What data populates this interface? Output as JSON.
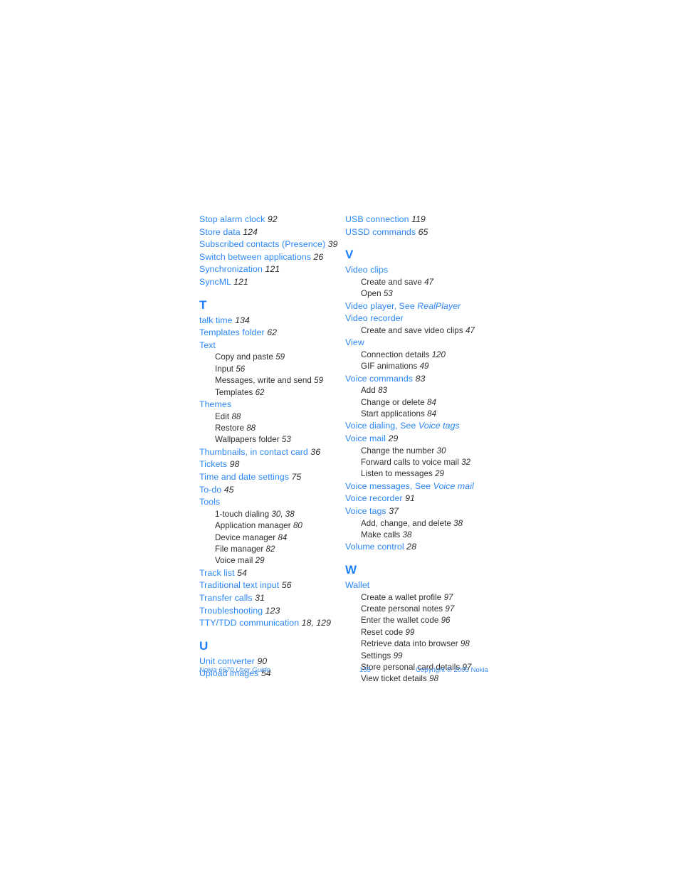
{
  "document": {
    "type": "index-page",
    "accent_color": "#2b87f4",
    "heading_color": "#1e7ffa",
    "body_color": "#2c2c2c",
    "background_color": "#ffffff"
  },
  "columns": [
    {
      "name": "left-column",
      "sections": [
        {
          "letter": "",
          "entries": [
            {
              "label": "Stop alarm clock",
              "page": "92",
              "subentries": []
            },
            {
              "label": "Store data",
              "page": "124",
              "subentries": []
            },
            {
              "label": "Subscribed contacts (Presence)",
              "page": "39",
              "subentries": []
            },
            {
              "label": "Switch between applications",
              "page": "26",
              "subentries": []
            },
            {
              "label": "Synchronization",
              "page": "121",
              "subentries": []
            },
            {
              "label": "SyncML",
              "page": "121",
              "subentries": []
            }
          ]
        },
        {
          "letter": "T",
          "entries": [
            {
              "label": "talk time",
              "page": "134",
              "subentries": []
            },
            {
              "label": "Templates folder",
              "page": "62",
              "subentries": []
            },
            {
              "label": "Text",
              "page": "",
              "subentries": [
                {
                  "label": "Copy and paste",
                  "page": "59"
                },
                {
                  "label": "Input",
                  "page": "56"
                },
                {
                  "label": "Messages, write and send",
                  "page": "59"
                },
                {
                  "label": "Templates",
                  "page": "62"
                }
              ]
            },
            {
              "label": "Themes",
              "page": "",
              "subentries": [
                {
                  "label": "Edit",
                  "page": "88"
                },
                {
                  "label": "Restore",
                  "page": "88"
                },
                {
                  "label": "Wallpapers folder",
                  "page": "53"
                }
              ]
            },
            {
              "label": "Thumbnails, in contact card",
              "page": "36",
              "subentries": []
            },
            {
              "label": "Tickets",
              "page": "98",
              "subentries": []
            },
            {
              "label": "Time and date settings",
              "page": "75",
              "subentries": []
            },
            {
              "label": "To-do",
              "page": "45",
              "subentries": []
            },
            {
              "label": "Tools",
              "page": "",
              "subentries": [
                {
                  "label": "1-touch dialing",
                  "page": "30, 38"
                },
                {
                  "label": "Application manager",
                  "page": "80"
                },
                {
                  "label": "Device manager",
                  "page": "84"
                },
                {
                  "label": "File manager",
                  "page": "82"
                },
                {
                  "label": "Voice mail",
                  "page": "29"
                }
              ]
            },
            {
              "label": "Track list",
              "page": "54",
              "subentries": []
            },
            {
              "label": "Traditional text input",
              "page": "56",
              "subentries": []
            },
            {
              "label": "Transfer calls",
              "page": "31",
              "subentries": []
            },
            {
              "label": "Troubleshooting",
              "page": "123",
              "subentries": []
            },
            {
              "label": "TTY/TDD communication",
              "page": "18, 129",
              "subentries": []
            }
          ]
        },
        {
          "letter": "U",
          "entries": [
            {
              "label": "Unit converter",
              "page": "90",
              "subentries": []
            },
            {
              "label": "Upload images",
              "page": "54",
              "subentries": []
            }
          ]
        }
      ]
    },
    {
      "name": "right-column",
      "sections": [
        {
          "letter": "",
          "entries": [
            {
              "label": "USB connection",
              "page": "119",
              "subentries": []
            },
            {
              "label": "USSD commands",
              "page": "65",
              "subentries": []
            }
          ]
        },
        {
          "letter": "V",
          "entries": [
            {
              "label": "Video clips",
              "page": "",
              "subentries": [
                {
                  "label": "Create and save",
                  "page": "47"
                },
                {
                  "label": "Open",
                  "page": "53"
                }
              ]
            },
            {
              "label": "Video player, See ",
              "page": "",
              "see": "RealPlayer",
              "subentries": []
            },
            {
              "label": "Video recorder",
              "page": "",
              "subentries": [
                {
                  "label": "Create and save video clips",
                  "page": "47"
                }
              ]
            },
            {
              "label": "View",
              "page": "",
              "subentries": [
                {
                  "label": "Connection details",
                  "page": "120"
                },
                {
                  "label": "GIF animations",
                  "page": "49"
                }
              ]
            },
            {
              "label": "Voice commands",
              "page": "83",
              "subentries": [
                {
                  "label": "Add",
                  "page": "83"
                },
                {
                  "label": "Change or delete",
                  "page": "84"
                },
                {
                  "label": "Start applications",
                  "page": "84"
                }
              ]
            },
            {
              "label": "Voice dialing, See ",
              "page": "",
              "see": "Voice tags",
              "subentries": []
            },
            {
              "label": "Voice mail",
              "page": "29",
              "subentries": [
                {
                  "label": "Change the number",
                  "page": "30"
                },
                {
                  "label": "Forward calls to voice mail",
                  "page": "32"
                },
                {
                  "label": "Listen to messages",
                  "page": "29"
                }
              ]
            },
            {
              "label": "Voice messages, See ",
              "page": "",
              "see": "Voice mail",
              "subentries": []
            },
            {
              "label": "Voice recorder",
              "page": "91",
              "subentries": []
            },
            {
              "label": "Voice tags",
              "page": "37",
              "subentries": [
                {
                  "label": "Add, change, and delete",
                  "page": "38"
                },
                {
                  "label": "Make calls",
                  "page": "38"
                }
              ]
            },
            {
              "label": "Volume control",
              "page": "28",
              "subentries": []
            }
          ]
        },
        {
          "letter": "W",
          "entries": [
            {
              "label": "Wallet",
              "page": "",
              "subentries": [
                {
                  "label": "Create a wallet profile",
                  "page": "97"
                },
                {
                  "label": "Create personal notes",
                  "page": "97"
                },
                {
                  "label": "Enter the wallet code",
                  "page": "96"
                },
                {
                  "label": "Reset code",
                  "page": "99"
                },
                {
                  "label": "Retrieve data into browser",
                  "page": "98"
                },
                {
                  "label": "Settings",
                  "page": "99"
                },
                {
                  "label": "Store personal card details",
                  "page": "97"
                },
                {
                  "label": "View ticket details",
                  "page": "98"
                }
              ]
            }
          ]
        }
      ]
    }
  ],
  "footer": {
    "left": "Nokia 6670 User Guide",
    "center": "155",
    "right": "Copyright © 2005 Nokia"
  }
}
